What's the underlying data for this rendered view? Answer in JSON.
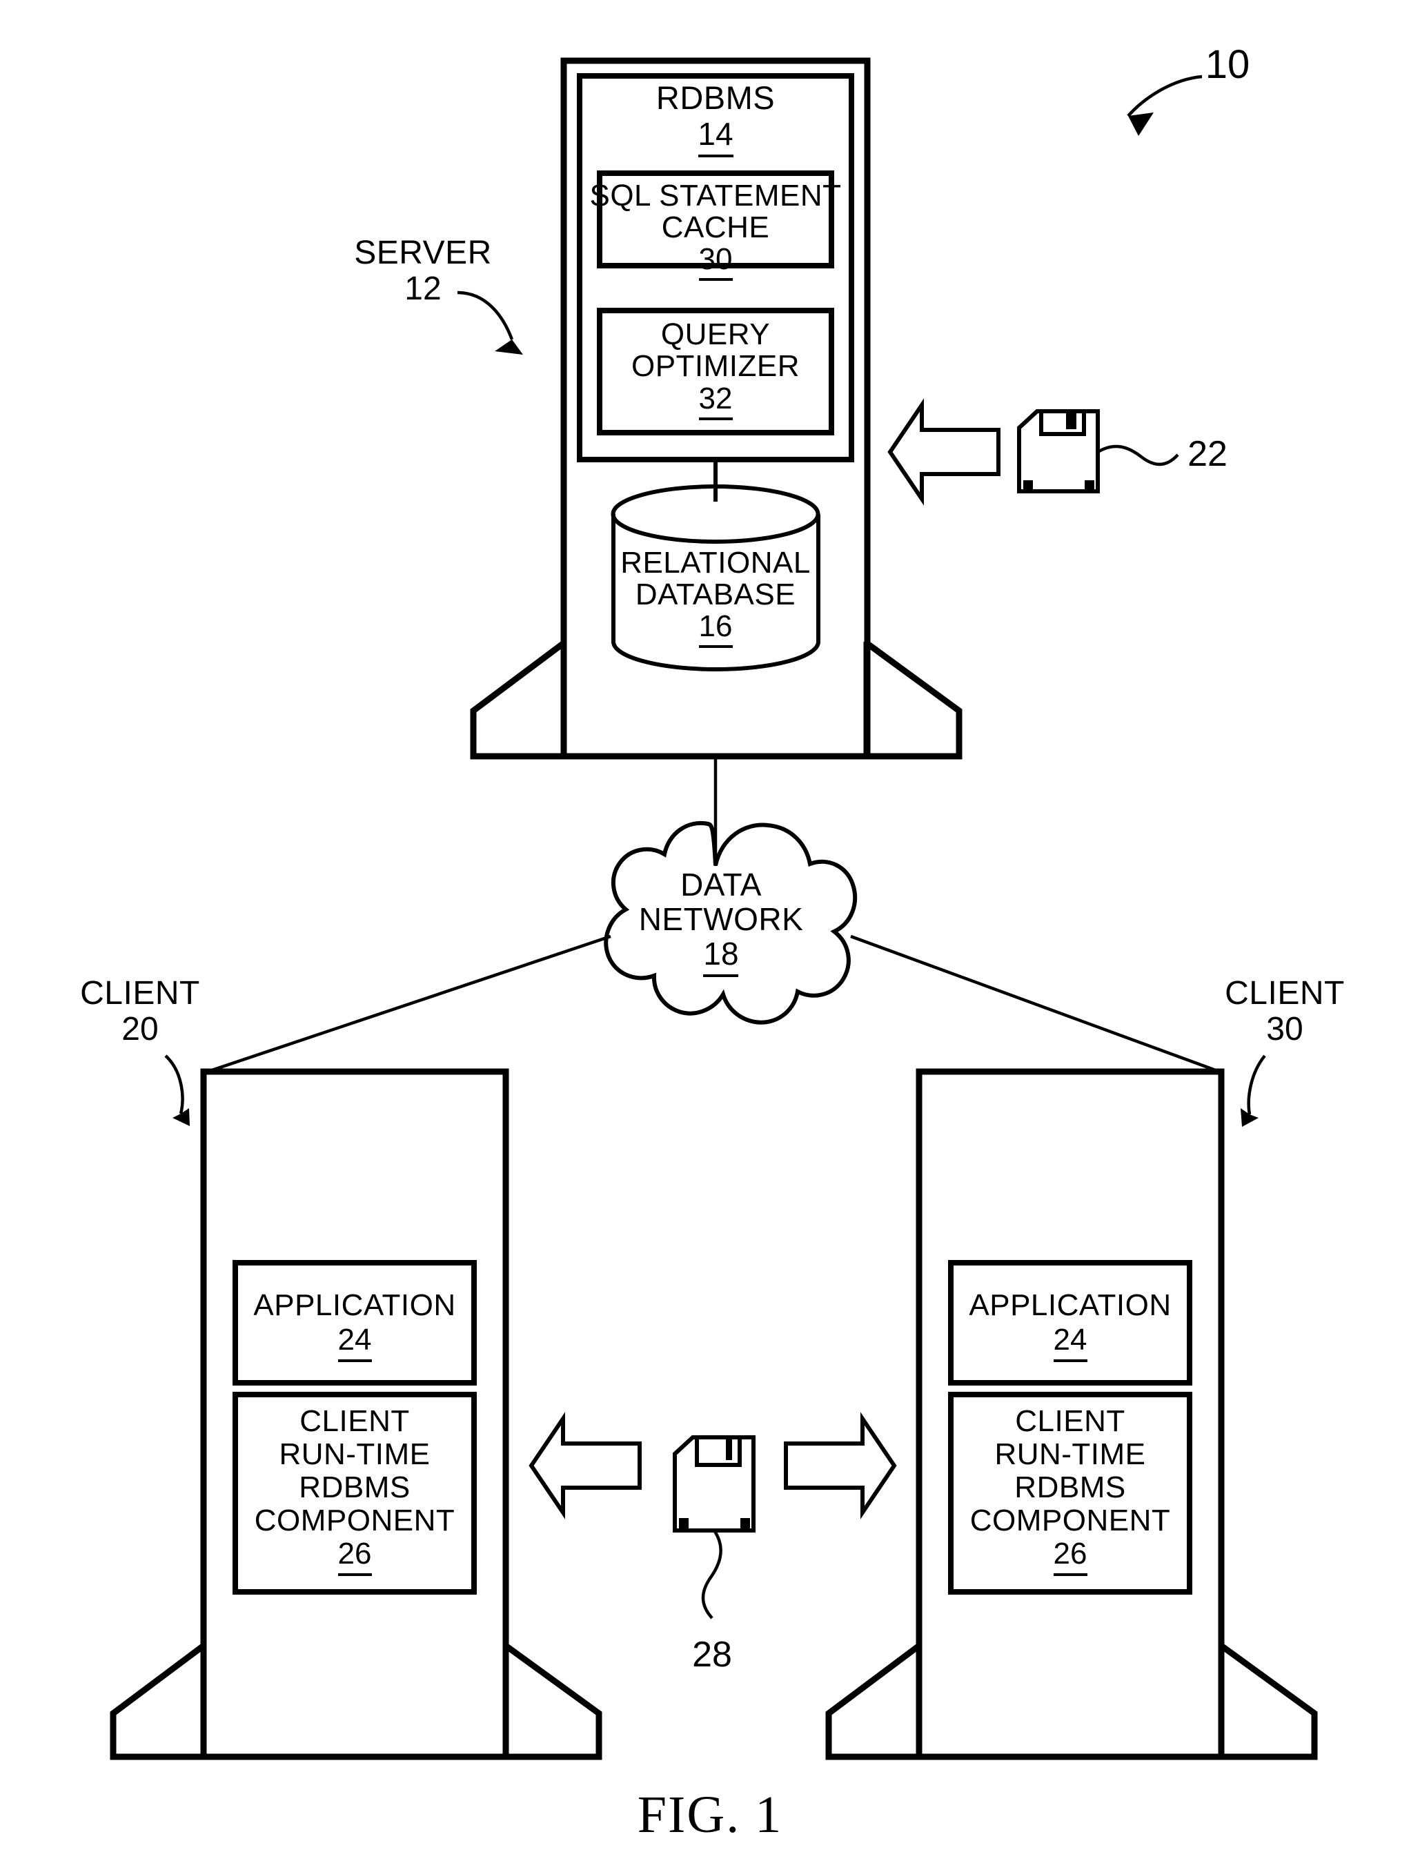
{
  "figure": {
    "caption": "FIG. 1",
    "overall_ref": "10"
  },
  "server": {
    "label": "SERVER",
    "ref": "12",
    "rdbms": {
      "label": "RDBMS",
      "ref": "14"
    },
    "sql_cache": {
      "line1": "SQL STATEMENT",
      "line2": "CACHE",
      "ref": "30"
    },
    "query_optimizer": {
      "line1": "QUERY",
      "line2": "OPTIMIZER",
      "ref": "32"
    },
    "database": {
      "line1": "RELATIONAL",
      "line2": "DATABASE",
      "ref": "16"
    },
    "media": {
      "icon": "floppy-disk-icon",
      "ref": "22",
      "arrow": "arrow-left"
    }
  },
  "network": {
    "line1": "DATA",
    "line2": "NETWORK",
    "ref": "18",
    "icon": "cloud-icon"
  },
  "clients": [
    {
      "label": "CLIENT",
      "ref": "20",
      "application": {
        "label": "APPLICATION",
        "ref": "24"
      },
      "runtime": {
        "line1": "CLIENT",
        "line2": "RUN-TIME",
        "line3": "RDBMS",
        "line4": "COMPONENT",
        "ref": "26"
      }
    },
    {
      "label": "CLIENT",
      "ref": "30",
      "application": {
        "label": "APPLICATION",
        "ref": "24"
      },
      "runtime": {
        "line1": "CLIENT",
        "line2": "RUN-TIME",
        "line3": "RDBMS",
        "line4": "COMPONENT",
        "ref": "26"
      }
    }
  ],
  "client_media": {
    "icon": "floppy-disk-icon",
    "ref": "28",
    "arrow_left": "arrow-left",
    "arrow_right": "arrow-right"
  },
  "colors": {
    "ink": "#000000",
    "paper": "#ffffff"
  }
}
